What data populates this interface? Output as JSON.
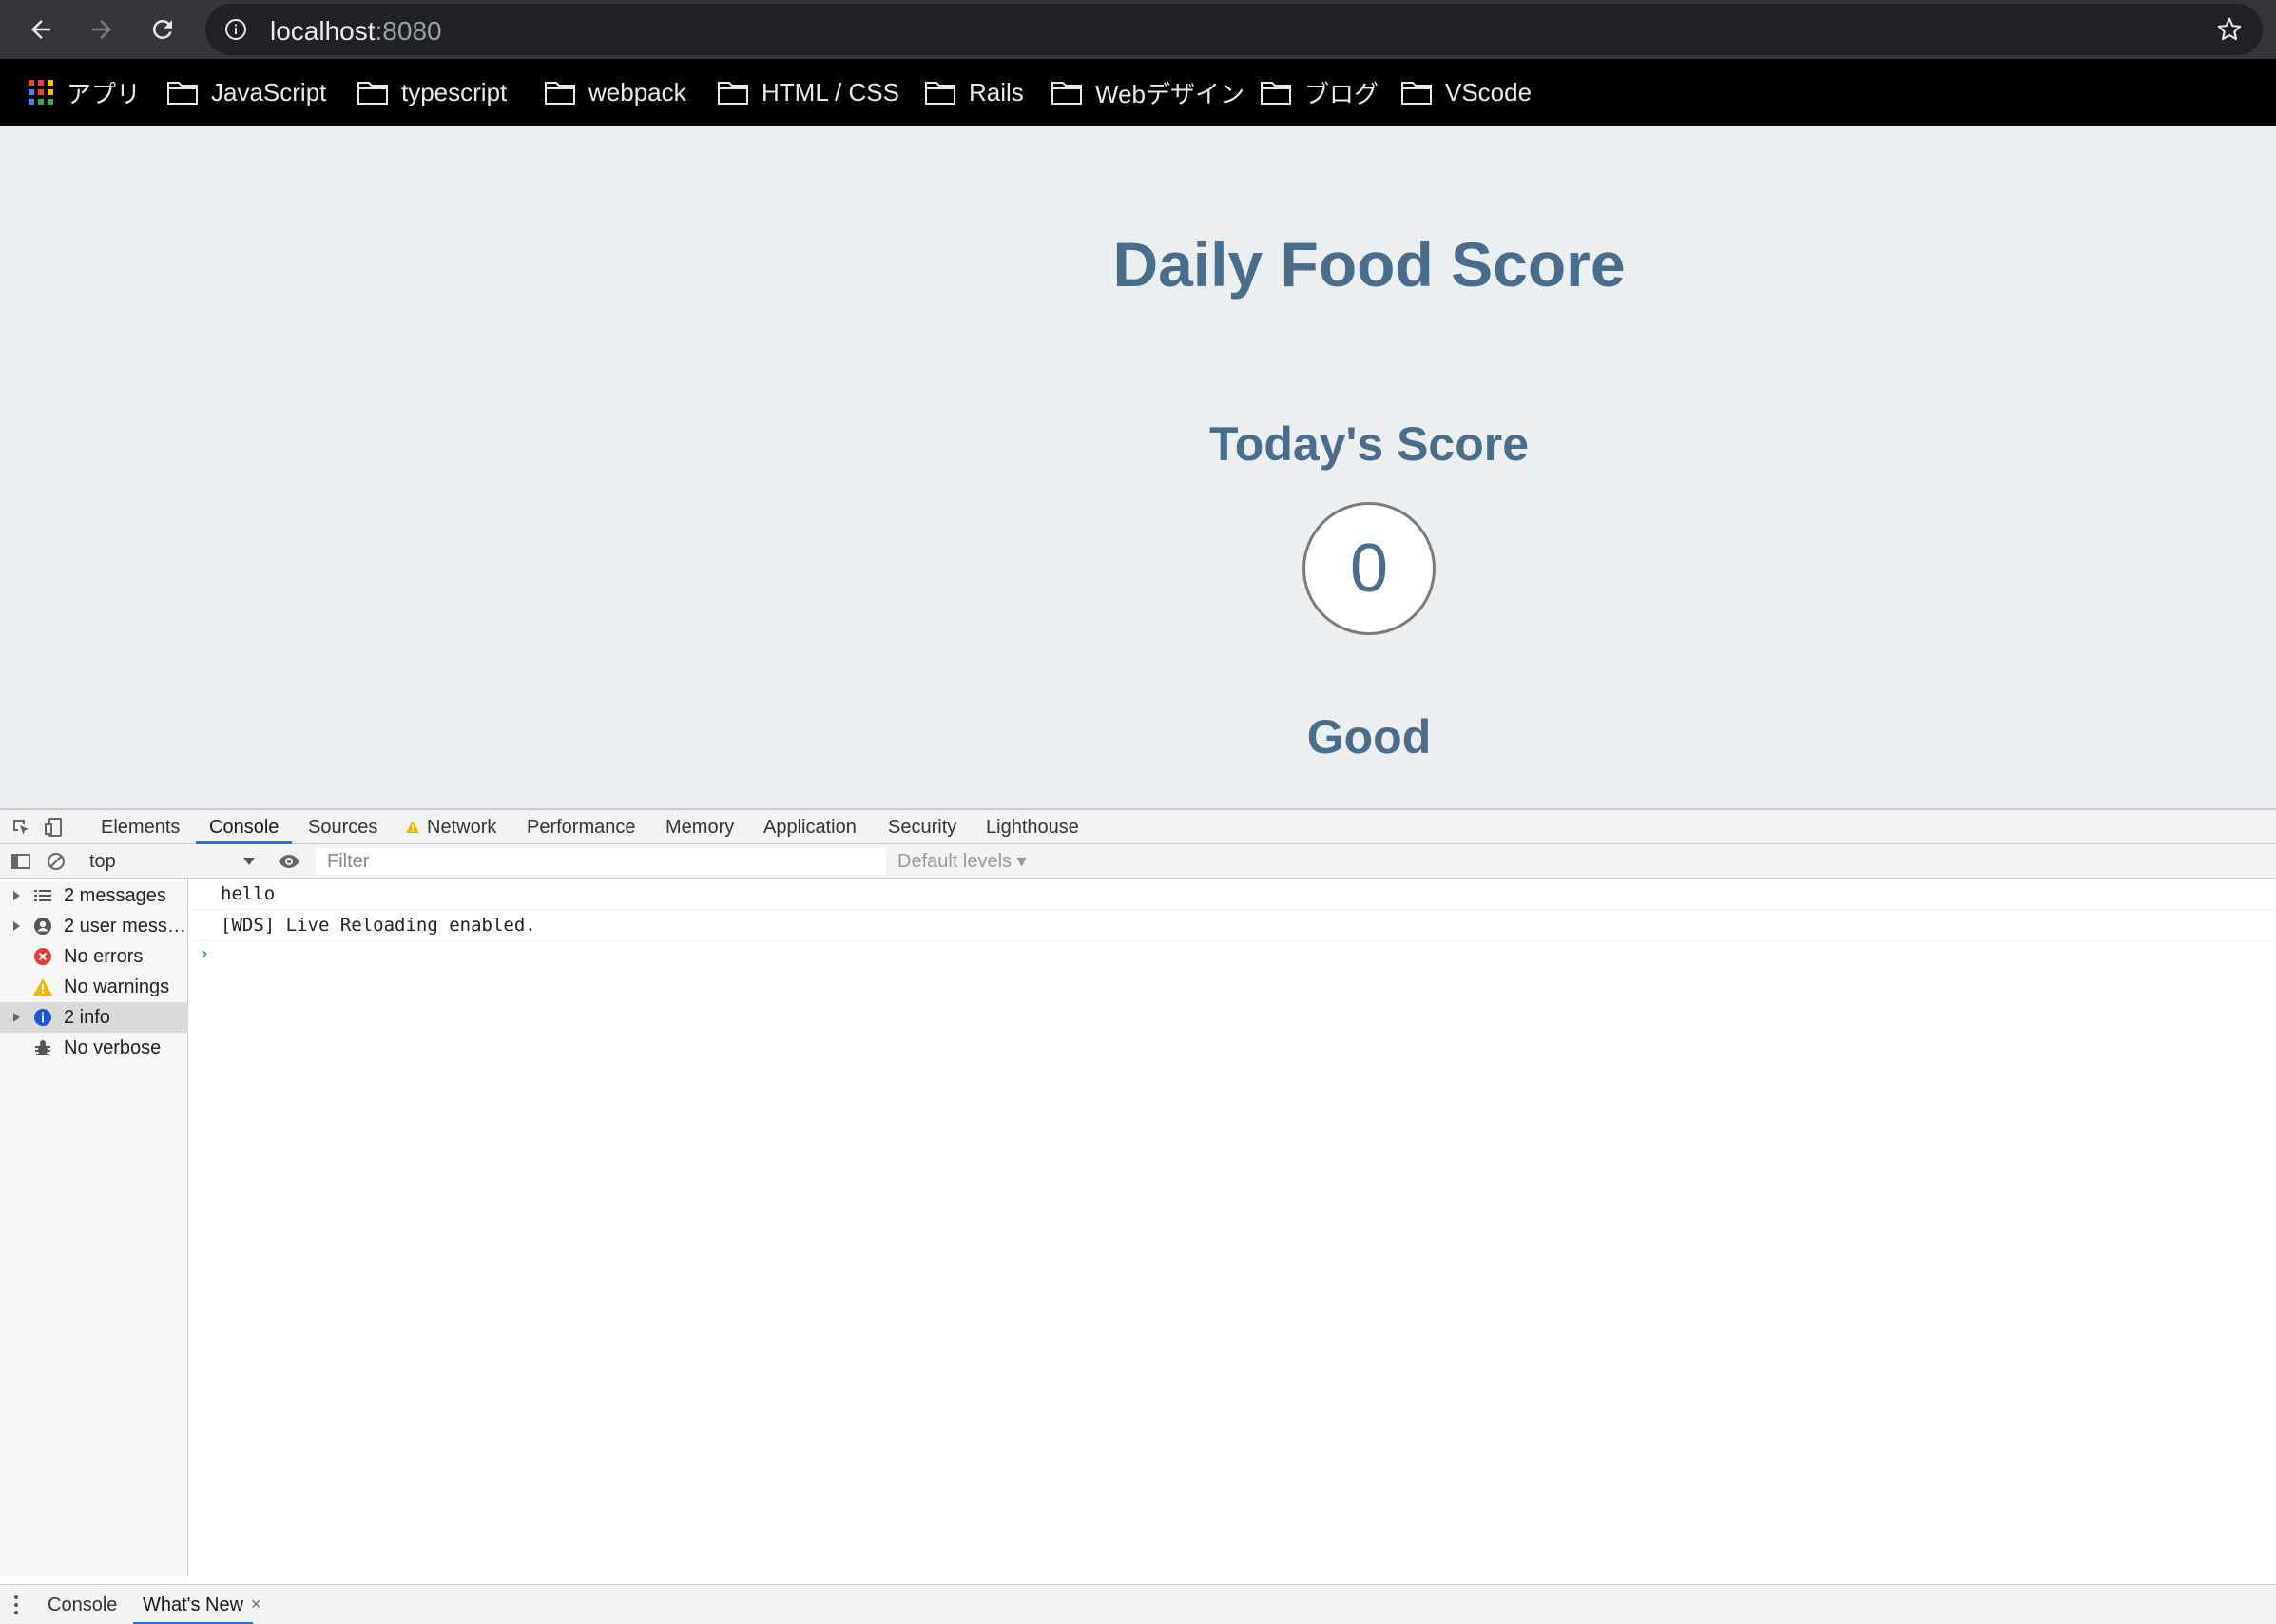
{
  "browser": {
    "url_host": "localhost",
    "url_port": ":8080",
    "bookmarks": [
      {
        "label": "アプリ",
        "icon": "apps-grid-icon"
      },
      {
        "label": "JavaScript",
        "icon": "folder-icon"
      },
      {
        "label": "typescript",
        "icon": "folder-icon"
      },
      {
        "label": "webpack",
        "icon": "folder-icon"
      },
      {
        "label": "HTML / CSS",
        "icon": "folder-icon"
      },
      {
        "label": "Rails",
        "icon": "folder-icon"
      },
      {
        "label": "Webデザイン",
        "icon": "folder-icon"
      },
      {
        "label": "ブログ",
        "icon": "folder-icon"
      },
      {
        "label": "VScode",
        "icon": "folder-icon"
      }
    ]
  },
  "app": {
    "title": "Daily Food Score",
    "score_heading": "Today's Score",
    "score": "0",
    "rating": "Good",
    "colors": {
      "text": "#4a6d8c",
      "background": "#eceff1"
    }
  },
  "devtools": {
    "tabs": [
      "Elements",
      "Console",
      "Sources",
      "Network",
      "Performance",
      "Memory",
      "Application",
      "Security",
      "Lighthouse"
    ],
    "active_tab": "Console",
    "context": "top",
    "filter_placeholder": "Filter",
    "levels": "Default levels ▾",
    "sidebar": [
      {
        "label": "2 messages",
        "icon": "list-icon"
      },
      {
        "label": "2 user mess…",
        "icon": "user-icon"
      },
      {
        "label": "No errors",
        "icon": "error-icon"
      },
      {
        "label": "No warnings",
        "icon": "warning-icon"
      },
      {
        "label": "2 info",
        "icon": "info-icon"
      },
      {
        "label": "No verbose",
        "icon": "bug-icon"
      }
    ],
    "logs": [
      "hello",
      "[WDS] Live Reloading enabled."
    ],
    "drawer_tabs": [
      "Console",
      "What's New"
    ],
    "close_glyph": "×"
  }
}
